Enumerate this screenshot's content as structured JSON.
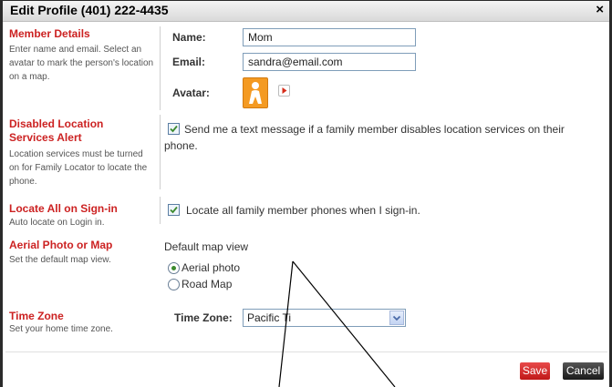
{
  "dialog": {
    "title": "Edit Profile (401) 222-4435",
    "close_glyph": "×"
  },
  "member_details": {
    "title": "Member Details",
    "description": "Enter name and email. Select an avatar to mark the person's location on a map.",
    "name_label": "Name:",
    "name_value": "Mom",
    "email_label": "Email:",
    "email_value": "sandra@email.com",
    "avatar_label": "Avatar:",
    "avatar_icon": "person-avatar-icon",
    "avatar_next_icon": "play-arrow-icon"
  },
  "disabled_location": {
    "title": "Disabled Location Services Alert",
    "description": "Location services must be turned on for Family Locator to locate the phone.",
    "checkbox_checked": true,
    "checkbox_label": "Send me a text message if a family member disables location services on their phone."
  },
  "locate_all": {
    "title": "Locate All on Sign-in",
    "description": "Auto locate on Login in.",
    "checkbox_checked": true,
    "checkbox_label": "Locate all family member phones when I sign-in."
  },
  "map_view": {
    "title": "Aerial Photo or Map",
    "description": "Set the default map view.",
    "heading": "Default map view",
    "options": [
      "Aerial photo",
      "Road Map"
    ],
    "selected": "Aerial photo"
  },
  "time_zone": {
    "title": "Time Zone",
    "description": "Set your home time zone.",
    "label": "Time Zone:",
    "value": "Pacific Ti"
  },
  "footer": {
    "save_label": "Save",
    "cancel_label": "Cancel"
  },
  "colors": {
    "section_title": "#cc2222",
    "save_button": "#d42626",
    "cancel_button": "#2a2a2a",
    "avatar_orange": "#f49a22",
    "check_green": "#3b8a2e"
  }
}
